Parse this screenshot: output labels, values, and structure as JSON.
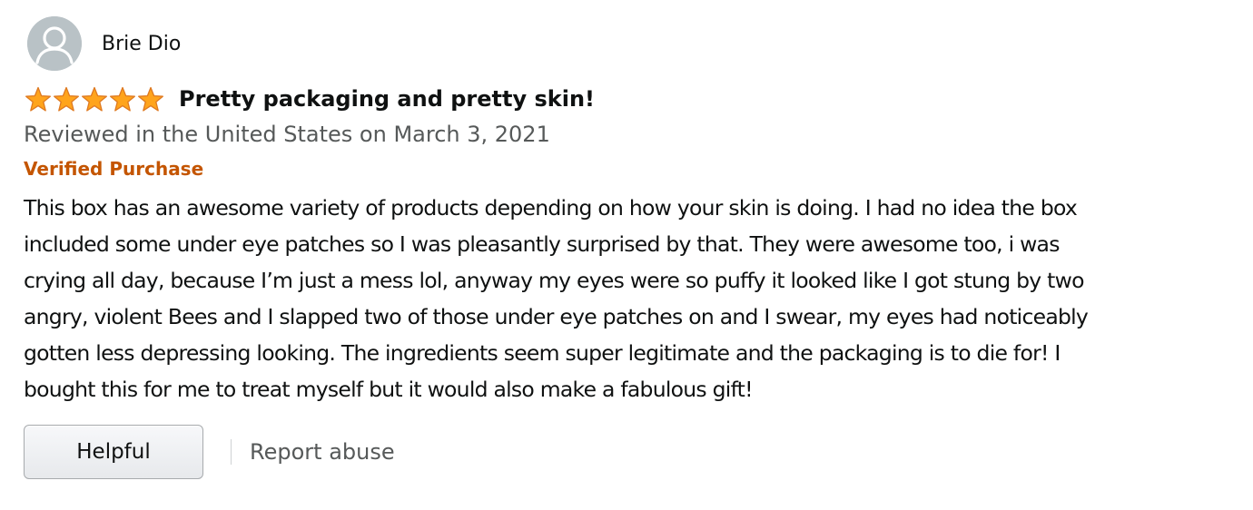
{
  "review": {
    "profile": {
      "name": "Brie Dio"
    },
    "rating": {
      "value": 5,
      "max": 5
    },
    "title": "Pretty packaging and pretty skin!",
    "date_line": "Reviewed in the United States on March 3, 2021",
    "verified_label": "Verified Purchase",
    "body_lines": [
      "This box has an awesome variety of products depending on how your skin is doing. I had no idea the box",
      "included some under eye patches so I was pleasantly surprised by that. They were awesome too, i was",
      "crying all day, because I’m just a mess lol, anyway my eyes were so puffy it looked like I got stung by two",
      "angry, violent Bees and I slapped two of those under eye patches on and I swear, my eyes had noticeably",
      "gotten less depressing looking. The ingredients seem super legitimate and the packaging is to die for! I",
      "bought this for me to treat myself but it would also make a fabulous gift!"
    ],
    "actions": {
      "helpful_label": "Helpful",
      "report_label": "Report abuse"
    }
  },
  "colors": {
    "star": "#ffa41c",
    "star_outline": "#de7921",
    "verified": "#c45500",
    "meta_text": "#565959",
    "avatar_bg": "#b9c2c6"
  },
  "icons": {
    "avatar": "user-silhouette-icon",
    "star": "star-filled-icon"
  }
}
